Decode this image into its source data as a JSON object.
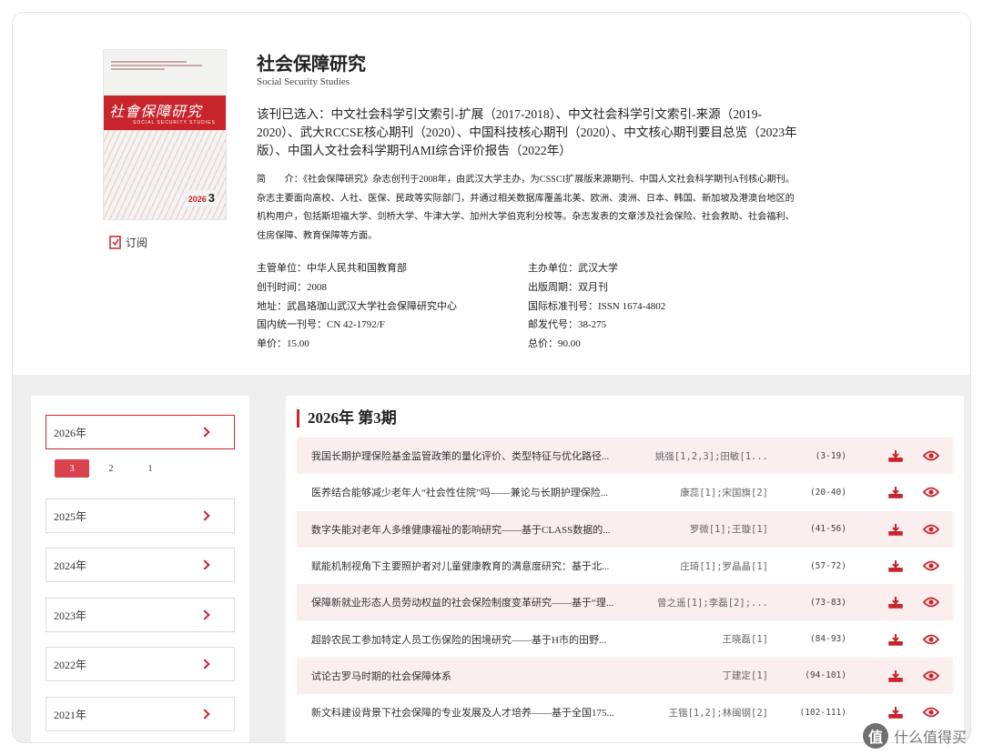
{
  "journal": {
    "cover_title": "社會保障研究",
    "cover_subtitle": "SOCIAL SECURITY STUDIES",
    "cover_year": "2026",
    "cover_issue": "3",
    "subscribe_label": "订阅",
    "title": "社会保障研究",
    "subtitle": "Social Security Studies",
    "indexed": "该刊已选入：中文社会科学引文索引-扩展（2017-2018）、中文社会科学引文索引-来源（2019-2020）、武大RCCSE核心期刊（2020）、中国科技核心期刊（2020）、中文核心期刊要目总览（2023年版）、中国人文社会科学期刊AMI综合评价报告（2022年）",
    "intro": "简　　介：《社会保障研究》杂志创刊于2008年，由武汉大学主办，为CSSCI扩展版来源期刊、中国人文社会科学期刊A刊核心期刊。杂志主要面向高校、人社、医保、民政等实际部门，并通过相关数据库覆盖北美、欧洲、澳洲、日本、韩国、新加坡及港澳台地区的机构用户，包括斯坦福大学、剑桥大学、牛津大学、加州大学伯克利分校等。杂志发表的文章涉及社会保险、社会救助、社会福利、住房保障、教育保障等方面。",
    "info": [
      "主管单位：中华人民共和国教育部",
      "主办单位：武汉大学",
      "创刊时间：2008",
      "出版周期：双月刊",
      "地址：武昌珞珈山武汉大学社会保障研究中心",
      "国际标准刊号：ISSN 1674-4802",
      "国内统一刊号：CN 42-1792/F",
      "邮发代号：38-275",
      "单价：15.00",
      "总价：90.00"
    ]
  },
  "sidebar": {
    "years": [
      "2026年",
      "2025年",
      "2024年",
      "2023年",
      "2022年",
      "2021年"
    ],
    "issues": [
      "3",
      "2",
      "1"
    ]
  },
  "main": {
    "heading": "2026年 第3期",
    "articles": [
      {
        "title": "我国长期护理保险基金监管政策的量化评价、类型特征与优化路径...",
        "authors": "姚强[1,2,3];田敏[1...",
        "pages": "(3-19)"
      },
      {
        "title": "医养结合能够减少老年人“社会性住院”吗——兼论与长期护理保险...",
        "authors": "康蕊[1];宋国旗[2]",
        "pages": "(20-40)"
      },
      {
        "title": "数字失能对老年人多维健康福祉的影响研究——基于CLASS数据的...",
        "authors": "罗微[1];王璇[1]",
        "pages": "(41-56)"
      },
      {
        "title": "赋能机制视角下主要照护者对儿童健康教育的满意度研究：基于北...",
        "authors": "庄琦[1];罗晶晶[1]",
        "pages": "(57-72)"
      },
      {
        "title": "保障新就业形态人员劳动权益的社会保险制度变革研究——基于“理...",
        "authors": "曾之遥[1];李磊[2];...",
        "pages": "(73-83)"
      },
      {
        "title": "超龄农民工参加特定人员工伤保险的困境研究——基于H市的田野...",
        "authors": "王晓磊[1]",
        "pages": "(84-93)"
      },
      {
        "title": "试论古罗马时期的社会保障体系",
        "authors": "丁建定[1]",
        "pages": "(94-101)"
      },
      {
        "title": "新文科建设背景下社会保障的专业发展及人才培养——基于全国175...",
        "authors": "王锴[1,2];林闽钢[2]",
        "pages": "(102-111)"
      }
    ]
  },
  "watermark": {
    "glyph": "值",
    "text": "什么值得买"
  },
  "colors": {
    "accent": "#c8242c",
    "row_shade": "#fbeeee",
    "background": "#efefef"
  }
}
